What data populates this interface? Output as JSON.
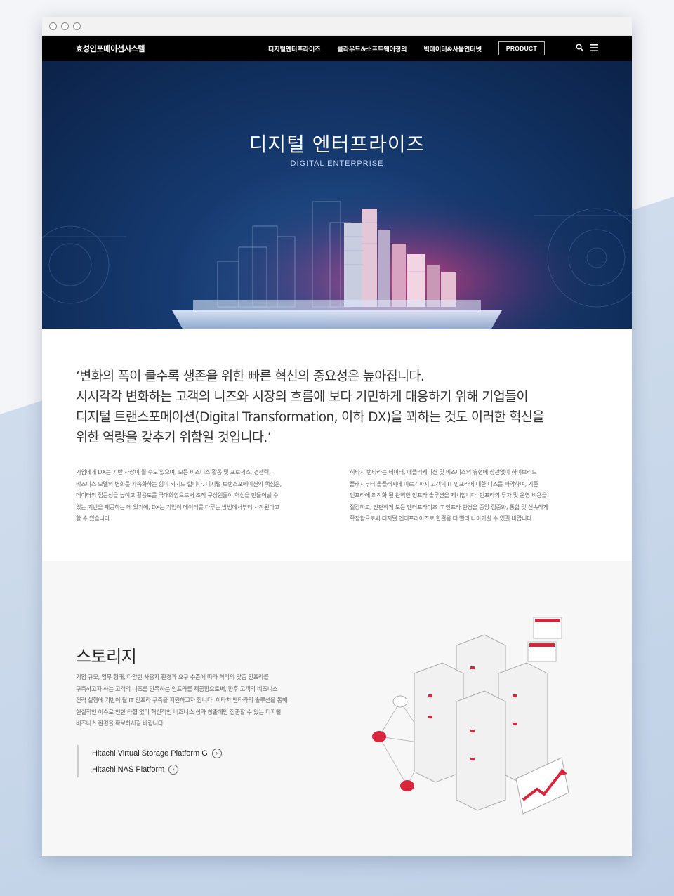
{
  "window": {
    "controls": [
      "dot",
      "dot",
      "dot"
    ]
  },
  "nav": {
    "logo": "효성인포메이션시스템",
    "items": [
      "디지털엔터프라이즈",
      "클라우드&소프트웨어정의",
      "빅데이터&사물인터넷"
    ],
    "product_label": "PRODUCT",
    "icons": [
      "search-icon",
      "hamburger-menu-icon"
    ]
  },
  "hero": {
    "title": "디지털 엔터프라이즈",
    "subtitle": "DIGITAL ENTERPRISE"
  },
  "intro": {
    "quote": [
      "‘변화의 폭이 클수록 생존을 위한 빠른 혁신의 중요성은 높아집니다.",
      "시시각각 변화하는 고객의 니즈와 시장의 흐름에 보다 기민하게 대응하기 위해 기업들이",
      "디지털 트랜스포메이션(Digital Transformation, 이하 DX)을 꾀하는 것도 이러한 혁신을",
      "위한 역량을 갖추기 위함일 것입니다.’"
    ],
    "col_left": [
      "기업에게 DX는 기반 사상이 될 수도 있으며, 모든 비즈니스 활동 및 프로세스, 경쟁력,",
      "비즈니스 모델의 변화를 가속화하는 힘이 되기도 합니다. 디지털 트랜스포메이션의 핵심은,",
      "데이터의 접근성을 높이고 활용도를 극대화함으로써 조직 구성원들이 혁신을 만들어낼 수",
      "있는 기반을 제공하는 데 있기에, DX는 기업이 데이터를 다루는 방법에서부터 시작된다고",
      "할 수 있습니다."
    ],
    "col_right": [
      "히타치 밴타라는 데이터, 애플리케이션 및 비즈니스의 유형에 상관없이 하이브리드",
      "플래시부터 올플래시에 이르기까지 고객의 IT 인프라에 대한 니즈를 파악하여, 기존",
      "인프라에 최적화 된 완벽한 인프라 솔루션을 제시합니다. 인프라의 투자 및 운영 비용을",
      "절감하고, 간편하게 모든 엔터프라이즈 IT 인프라 환경을 중앙 집중화, 통합 및 신속하게",
      "확장함으로써 디지털 엔터프라이즈로 한걸음 더 빨리 나아가실 수 있길 바랍니다."
    ]
  },
  "storage": {
    "title": "스토리지",
    "body": [
      "기업 규모, 업무 형태, 다양한 사용자 환경과 요구 수준에 따라 최적의 맞춤 인프라를",
      "구축하고자 하는 고객의 니즈를 만족하는 인프라를 제공함으로써, 향후 고객의 비즈니스",
      "전략 실행에 기반이 될 IT 인프라 구축을 지원하고자 합니다. 히타치 밴타라의 솔루션을 통해",
      "현실적인 이슈로 인한 타협 없이 혁신적인 비즈니스 성과 창출에만 집중할 수 있는 디지털",
      "비즈니스 환경을 확보하시길 바랍니다."
    ],
    "links": [
      "Hitachi Virtual Storage Platform G",
      "Hitachi NAS Platform"
    ]
  },
  "colors": {
    "nav_bg": "#000000",
    "hero_bg": "#163a70",
    "accent_red": "#d9263d"
  }
}
